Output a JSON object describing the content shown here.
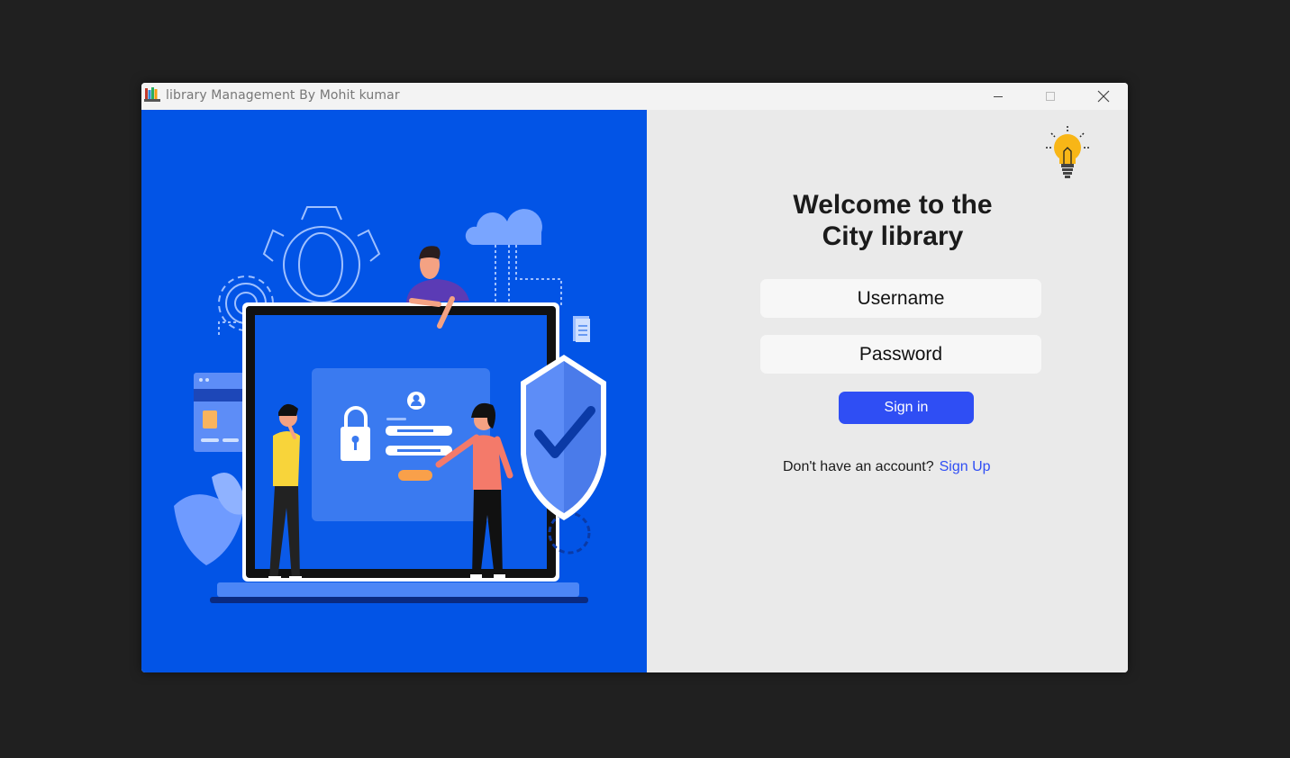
{
  "window": {
    "title": "library Management By Mohit kumar",
    "controls": [
      "minimize",
      "maximize",
      "close"
    ]
  },
  "illustration": {
    "icon": "login-security-illustration",
    "background_color": "#0254e6"
  },
  "login": {
    "welcome_line1": "Welcome to the",
    "welcome_line2": "City library",
    "username_placeholder": "Username",
    "password_placeholder": "Password",
    "signin_label": "Sign in",
    "no_account_text": "Don't have an account?",
    "signup_label": "Sign Up",
    "bulb_icon": "lightbulb-icon",
    "accent_color": "#2f4ef4"
  }
}
